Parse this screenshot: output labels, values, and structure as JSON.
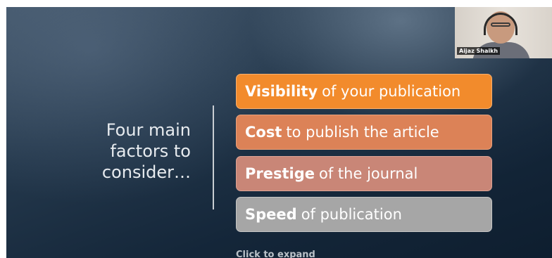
{
  "slide": {
    "heading": "Four main factors to consider…",
    "factors": [
      {
        "bold": "Visibility",
        "rest": "of your publication",
        "color": "#f28b2c"
      },
      {
        "bold": "Cost",
        "rest": "to publish the article",
        "color": "#dc8257"
      },
      {
        "bold": "Prestige",
        "rest": "of the journal",
        "color": "#c98677"
      },
      {
        "bold": "Speed",
        "rest": "of publication",
        "color": "#a6a6a6"
      }
    ],
    "hint": "Click to expand"
  },
  "video_feed": {
    "participant_name": "Aijaz Shaikh"
  }
}
